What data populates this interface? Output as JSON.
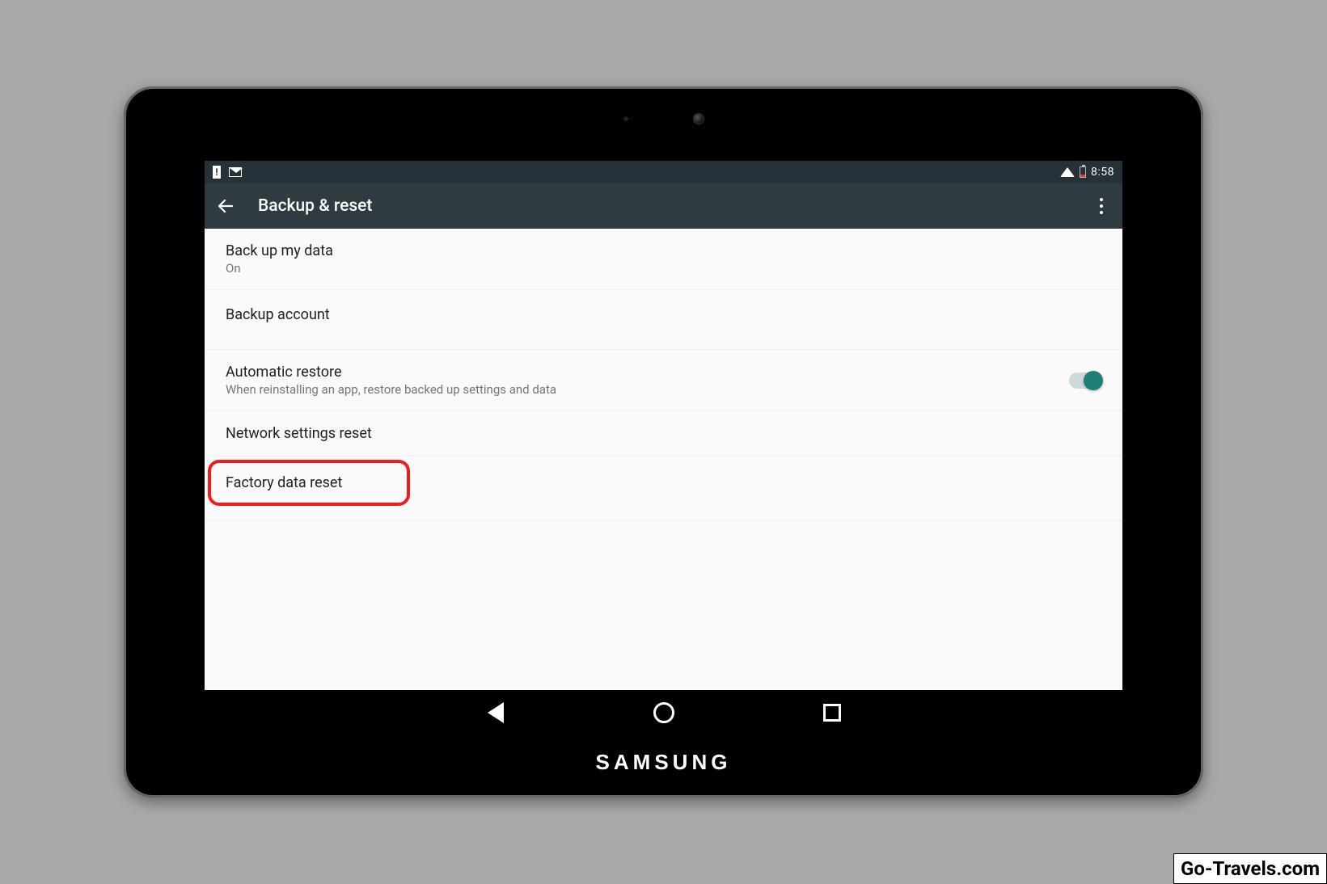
{
  "status_bar": {
    "clock": "8:58"
  },
  "header": {
    "title": "Backup & reset"
  },
  "items": {
    "backup_data": {
      "title": "Back up my data",
      "sub": "On"
    },
    "backup_account": {
      "title": "Backup account"
    },
    "auto_restore": {
      "title": "Automatic restore",
      "sub": "When reinstalling an app, restore backed up settings and data"
    },
    "network_reset": {
      "title": "Network settings reset"
    },
    "factory_reset": {
      "title": "Factory data reset"
    }
  },
  "brand": "SAMSUNG",
  "watermark": "Go-Travels.com"
}
